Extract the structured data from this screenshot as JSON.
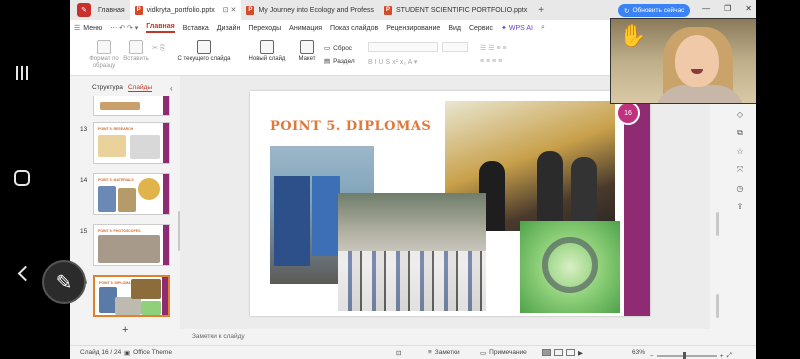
{
  "tabs": [
    {
      "label": "Главная",
      "active": false
    },
    {
      "label": "vidkryta_portfolio.pptx",
      "active": true
    },
    {
      "label": "My Journey into Ecology and Profess",
      "active": false
    },
    {
      "label": "STUDENT SCIENTIFIC PORTFOLIO.pptx",
      "active": false
    }
  ],
  "update_button": "Обновить сейчас",
  "menu": {
    "file": "Меню",
    "items": [
      "Главная",
      "Вставка",
      "Дизайн",
      "Переходы",
      "Анимация",
      "Показ слайдов",
      "Рецензирование",
      "Вид",
      "Сервис"
    ],
    "wps_ai": "WPS AI"
  },
  "ribbon": {
    "format_painter": "Формат по образцу",
    "paste": "Вставить",
    "from_current": "С текущего слайда",
    "new_slide": "Новый слайд",
    "layout": "Макет",
    "reset": "Сброс",
    "section": "Раздел"
  },
  "panel": {
    "tab_structure": "Структура",
    "tab_slides": "Слайды",
    "thumbnails": [
      {
        "num": "13",
        "title": "POINT 5. RESEARCH",
        "selected": false
      },
      {
        "num": "14",
        "title": "POINT 5. MATERIALS",
        "selected": false
      },
      {
        "num": "15",
        "title": "POINT 5. PHOTOSCOPES",
        "selected": false
      },
      {
        "num": "16",
        "title": "POINT 5. DIPLOMAS",
        "selected": true
      }
    ]
  },
  "slide": {
    "title": "POINT 5. DIPLOMAS",
    "badge": "16"
  },
  "notes_placeholder": "Заметки к слайду",
  "status": {
    "slide_counter": "Слайд 16 / 24",
    "theme": "Office Theme",
    "notes": "Заметки",
    "comments": "Примечание",
    "zoom": "63%"
  }
}
